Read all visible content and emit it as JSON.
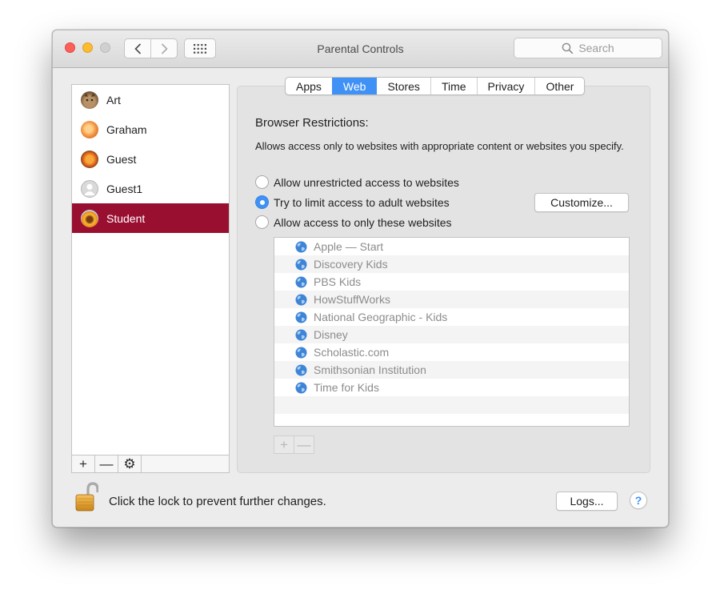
{
  "window": {
    "title": "Parental Controls",
    "search_placeholder": "Search"
  },
  "users": [
    {
      "name": "Art",
      "avatar": "cat-avatar",
      "selected": false
    },
    {
      "name": "Graham",
      "avatar": "orange-avatar",
      "selected": false
    },
    {
      "name": "Guest",
      "avatar": "flower-avatar",
      "selected": false
    },
    {
      "name": "Guest1",
      "avatar": "generic-user-avatar",
      "selected": false
    },
    {
      "name": "Student",
      "avatar": "sunflower-avatar",
      "selected": true
    }
  ],
  "user_list_footer": {
    "add": "+",
    "remove": "—",
    "action": "⚙"
  },
  "tabs": [
    {
      "label": "Apps",
      "active": false
    },
    {
      "label": "Web",
      "active": true
    },
    {
      "label": "Stores",
      "active": false
    },
    {
      "label": "Time",
      "active": false
    },
    {
      "label": "Privacy",
      "active": false
    },
    {
      "label": "Other",
      "active": false
    }
  ],
  "web": {
    "section_title": "Browser Restrictions:",
    "description": "Allows access only to websites with appropriate content or websites you specify.",
    "options": [
      {
        "label": "Allow unrestricted access to websites",
        "checked": false
      },
      {
        "label": "Try to limit access to adult websites",
        "checked": true
      },
      {
        "label": "Allow access to only these websites",
        "checked": false
      }
    ],
    "customize_label": "Customize...",
    "sites": [
      "Apple — Start",
      "Discovery Kids",
      "PBS Kids",
      "HowStuffWorks",
      "National Geographic - Kids",
      "Disney",
      "Scholastic.com",
      "Smithsonian Institution",
      "Time for Kids"
    ],
    "site_add": "+",
    "site_remove": "—"
  },
  "footer": {
    "lock_text": "Click the lock to prevent further changes.",
    "logs_label": "Logs...",
    "help_label": "?"
  },
  "colors": {
    "selection": "#990f30",
    "accent": "#3f91f6",
    "disabled_text": "#8c8c8c"
  }
}
